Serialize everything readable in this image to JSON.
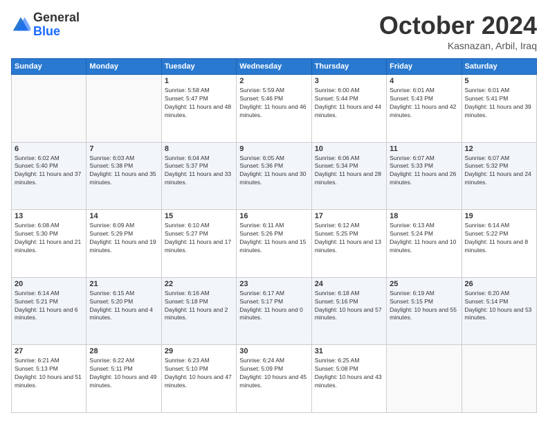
{
  "header": {
    "logo": {
      "line1": "General",
      "line2": "Blue"
    },
    "title": "October 2024",
    "location": "Kasnazan, Arbil, Iraq"
  },
  "weekdays": [
    "Sunday",
    "Monday",
    "Tuesday",
    "Wednesday",
    "Thursday",
    "Friday",
    "Saturday"
  ],
  "weeks": [
    [
      {
        "day": "",
        "info": ""
      },
      {
        "day": "",
        "info": ""
      },
      {
        "day": "1",
        "info": "Sunrise: 5:58 AM\nSunset: 5:47 PM\nDaylight: 11 hours and 48 minutes."
      },
      {
        "day": "2",
        "info": "Sunrise: 5:59 AM\nSunset: 5:46 PM\nDaylight: 11 hours and 46 minutes."
      },
      {
        "day": "3",
        "info": "Sunrise: 6:00 AM\nSunset: 5:44 PM\nDaylight: 11 hours and 44 minutes."
      },
      {
        "day": "4",
        "info": "Sunrise: 6:01 AM\nSunset: 5:43 PM\nDaylight: 11 hours and 42 minutes."
      },
      {
        "day": "5",
        "info": "Sunrise: 6:01 AM\nSunset: 5:41 PM\nDaylight: 11 hours and 39 minutes."
      }
    ],
    [
      {
        "day": "6",
        "info": "Sunrise: 6:02 AM\nSunset: 5:40 PM\nDaylight: 11 hours and 37 minutes."
      },
      {
        "day": "7",
        "info": "Sunrise: 6:03 AM\nSunset: 5:38 PM\nDaylight: 11 hours and 35 minutes."
      },
      {
        "day": "8",
        "info": "Sunrise: 6:04 AM\nSunset: 5:37 PM\nDaylight: 11 hours and 33 minutes."
      },
      {
        "day": "9",
        "info": "Sunrise: 6:05 AM\nSunset: 5:36 PM\nDaylight: 11 hours and 30 minutes."
      },
      {
        "day": "10",
        "info": "Sunrise: 6:06 AM\nSunset: 5:34 PM\nDaylight: 11 hours and 28 minutes."
      },
      {
        "day": "11",
        "info": "Sunrise: 6:07 AM\nSunset: 5:33 PM\nDaylight: 11 hours and 26 minutes."
      },
      {
        "day": "12",
        "info": "Sunrise: 6:07 AM\nSunset: 5:32 PM\nDaylight: 11 hours and 24 minutes."
      }
    ],
    [
      {
        "day": "13",
        "info": "Sunrise: 6:08 AM\nSunset: 5:30 PM\nDaylight: 11 hours and 21 minutes."
      },
      {
        "day": "14",
        "info": "Sunrise: 6:09 AM\nSunset: 5:29 PM\nDaylight: 11 hours and 19 minutes."
      },
      {
        "day": "15",
        "info": "Sunrise: 6:10 AM\nSunset: 5:27 PM\nDaylight: 11 hours and 17 minutes."
      },
      {
        "day": "16",
        "info": "Sunrise: 6:11 AM\nSunset: 5:26 PM\nDaylight: 11 hours and 15 minutes."
      },
      {
        "day": "17",
        "info": "Sunrise: 6:12 AM\nSunset: 5:25 PM\nDaylight: 11 hours and 13 minutes."
      },
      {
        "day": "18",
        "info": "Sunrise: 6:13 AM\nSunset: 5:24 PM\nDaylight: 11 hours and 10 minutes."
      },
      {
        "day": "19",
        "info": "Sunrise: 6:14 AM\nSunset: 5:22 PM\nDaylight: 11 hours and 8 minutes."
      }
    ],
    [
      {
        "day": "20",
        "info": "Sunrise: 6:14 AM\nSunset: 5:21 PM\nDaylight: 11 hours and 6 minutes."
      },
      {
        "day": "21",
        "info": "Sunrise: 6:15 AM\nSunset: 5:20 PM\nDaylight: 11 hours and 4 minutes."
      },
      {
        "day": "22",
        "info": "Sunrise: 6:16 AM\nSunset: 5:18 PM\nDaylight: 11 hours and 2 minutes."
      },
      {
        "day": "23",
        "info": "Sunrise: 6:17 AM\nSunset: 5:17 PM\nDaylight: 11 hours and 0 minutes."
      },
      {
        "day": "24",
        "info": "Sunrise: 6:18 AM\nSunset: 5:16 PM\nDaylight: 10 hours and 57 minutes."
      },
      {
        "day": "25",
        "info": "Sunrise: 6:19 AM\nSunset: 5:15 PM\nDaylight: 10 hours and 55 minutes."
      },
      {
        "day": "26",
        "info": "Sunrise: 6:20 AM\nSunset: 5:14 PM\nDaylight: 10 hours and 53 minutes."
      }
    ],
    [
      {
        "day": "27",
        "info": "Sunrise: 6:21 AM\nSunset: 5:13 PM\nDaylight: 10 hours and 51 minutes."
      },
      {
        "day": "28",
        "info": "Sunrise: 6:22 AM\nSunset: 5:11 PM\nDaylight: 10 hours and 49 minutes."
      },
      {
        "day": "29",
        "info": "Sunrise: 6:23 AM\nSunset: 5:10 PM\nDaylight: 10 hours and 47 minutes."
      },
      {
        "day": "30",
        "info": "Sunrise: 6:24 AM\nSunset: 5:09 PM\nDaylight: 10 hours and 45 minutes."
      },
      {
        "day": "31",
        "info": "Sunrise: 6:25 AM\nSunset: 5:08 PM\nDaylight: 10 hours and 43 minutes."
      },
      {
        "day": "",
        "info": ""
      },
      {
        "day": "",
        "info": ""
      }
    ]
  ]
}
